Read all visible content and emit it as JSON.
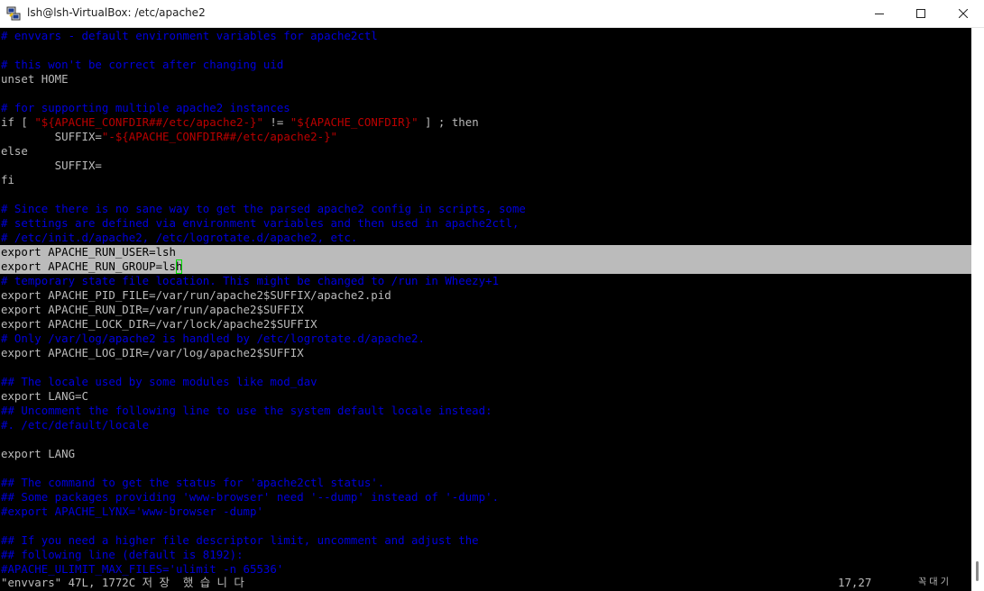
{
  "window": {
    "title": "lsh@lsh-VirtualBox: /etc/apache2"
  },
  "colors": {
    "comment": "#0000dd",
    "string": "#bb0000",
    "text": "#bbbbbb",
    "selection": "#bbbbbb",
    "cursor": "#00dd00"
  },
  "terminal": {
    "lines": [
      [
        {
          "t": "# envvars - default environment variables for apache2ctl",
          "c": "blue"
        }
      ],
      [],
      [
        {
          "t": "# this won't be correct after changing uid",
          "c": "blue"
        }
      ],
      [
        {
          "t": "unset HOME",
          "c": "white"
        }
      ],
      [],
      [
        {
          "t": "# for supporting multiple apache2 instances",
          "c": "blue"
        }
      ],
      [
        {
          "t": "if [ ",
          "c": "white"
        },
        {
          "t": "\"${APACHE_CONFDIR##/etc/apache2-}\"",
          "c": "red"
        },
        {
          "t": " != ",
          "c": "white"
        },
        {
          "t": "\"${APACHE_CONFDIR}\"",
          "c": "red"
        },
        {
          "t": " ] ; then",
          "c": "white"
        }
      ],
      [
        {
          "t": "        SUFFIX=",
          "c": "white"
        },
        {
          "t": "\"-${APACHE_CONFDIR##/etc/apache2-}\"",
          "c": "red"
        }
      ],
      [
        {
          "t": "else",
          "c": "white"
        }
      ],
      [
        {
          "t": "        SUFFIX=",
          "c": "white"
        }
      ],
      [
        {
          "t": "fi",
          "c": "white"
        }
      ],
      [],
      [
        {
          "t": "# Since there is no sane way to get the parsed apache2 config in scripts, some",
          "c": "blue"
        }
      ],
      [
        {
          "t": "# settings are defined via environment variables and then used in apache2ctl,",
          "c": "blue"
        }
      ],
      [
        {
          "t": "# /etc/init.d/apache2, /etc/logrotate.d/apache2, etc.",
          "c": "blue"
        }
      ],
      [
        {
          "t": "export APACHE_RUN_USER=lsh",
          "c": "dark"
        }
      ],
      [
        {
          "t": "export APACHE_RUN_GROUP=ls",
          "c": "dark"
        },
        {
          "t": "h",
          "c": "cursor"
        }
      ],
      [
        {
          "t": "# temporary state file location. This might be changed to /run in Wheezy+1",
          "c": "blue"
        }
      ],
      [
        {
          "t": "export APACHE_PID_FILE=/var/run/apache2$SUFFIX/apache2.pid",
          "c": "white"
        }
      ],
      [
        {
          "t": "export APACHE_RUN_DIR=/var/run/apache2$SUFFIX",
          "c": "white"
        }
      ],
      [
        {
          "t": "export APACHE_LOCK_DIR=/var/lock/apache2$SUFFIX",
          "c": "white"
        }
      ],
      [
        {
          "t": "# Only /var/log/apache2 is handled by /etc/logrotate.d/apache2.",
          "c": "blue"
        }
      ],
      [
        {
          "t": "export APACHE_LOG_DIR=/var/log/apache2$SUFFIX",
          "c": "white"
        }
      ],
      [],
      [
        {
          "t": "## The locale used by some modules like mod_dav",
          "c": "blue"
        }
      ],
      [
        {
          "t": "export LANG=C",
          "c": "white"
        }
      ],
      [
        {
          "t": "## Uncomment the following line to use the system default locale instead:",
          "c": "blue"
        }
      ],
      [
        {
          "t": "#. /etc/default/locale",
          "c": "blue"
        }
      ],
      [],
      [
        {
          "t": "export LANG",
          "c": "white"
        }
      ],
      [],
      [
        {
          "t": "## The command to get the status for 'apache2ctl status'.",
          "c": "blue"
        }
      ],
      [
        {
          "t": "## Some packages providing 'www-browser' need '--dump' instead of '-dump'.",
          "c": "blue"
        }
      ],
      [
        {
          "t": "#export APACHE_LYNX='www-browser -dump'",
          "c": "blue"
        }
      ],
      [],
      [
        {
          "t": "## If you need a higher file descriptor limit, uncomment and adjust the",
          "c": "blue"
        }
      ],
      [
        {
          "t": "## following line (default is 8192):",
          "c": "blue"
        }
      ],
      [
        {
          "t": "#APACHE_ULIMIT_MAX_FILES='ulimit -n 65536'",
          "c": "blue"
        }
      ]
    ],
    "selected_lines": [
      15,
      16
    ]
  },
  "status": {
    "file_info": "\"envvars\" 47L, 1772C 저 장  했 습 니 다",
    "cursor_pos": "17,27",
    "scroll_pos": "꼭 대 기"
  }
}
